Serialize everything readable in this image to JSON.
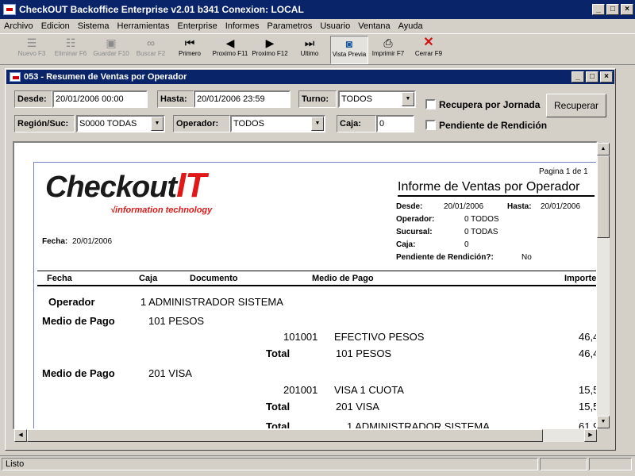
{
  "window": {
    "title": "CheckOUT Backoffice Enterprise v2.01 b341 Conexion: LOCAL"
  },
  "menu": [
    "Archivo",
    "Edicion",
    "Sistema",
    "Herramientas",
    "Enterprise",
    "Informes",
    "Parametros",
    "Usuario",
    "Ventana",
    "Ayuda"
  ],
  "toolbar": {
    "nuevo": "Nuevo F3",
    "eliminar": "Eliminar F6",
    "guardar": "Guardar F10",
    "buscar": "Buscar F2",
    "primero": "Primero",
    "proximo_f11": "Proximo F11",
    "proximo_f12": "Proximo F12",
    "ultimo": "Ultimo",
    "vista": "Vista Previa",
    "imprimir": "Imprimir F7",
    "cerrar": "Cerrar F9"
  },
  "child": {
    "title": "053 - Resumen de Ventas por Operador"
  },
  "filters": {
    "desde_label": "Desde:",
    "desde": "20/01/2006 00:00",
    "hasta_label": "Hasta:",
    "hasta": "20/01/2006 23:59",
    "turno_label": "Turno:",
    "turno": "TODOS",
    "region_label": "Región/Suc:",
    "region": "S0000 TODAS",
    "operador_label": "Operador:",
    "operador": "TODOS",
    "caja_label": "Caja:",
    "caja": "0",
    "recupera_jornada": "Recupera por Jornada",
    "pendiente": "Pendiente de Rendición",
    "recuperar": "Recuperar"
  },
  "report": {
    "logo_text": "Checkout",
    "logo_it": "IT",
    "logo_sub": "information technology",
    "pagina": "Pagina 1 de 1",
    "title": "Informe de Ventas por Operador",
    "desde_l": "Desde:",
    "desde_v": "20/01/2006",
    "hasta_l": "Hasta:",
    "hasta_v": "20/01/2006",
    "operador_l": "Operador:",
    "operador_v": "0 TODOS",
    "sucursal_l": "Sucursal:",
    "sucursal_v": "0 TODAS",
    "caja_l": "Caja:",
    "caja_v": "0",
    "pend_l": "Pendiente de Rendición?:",
    "pend_v": "No",
    "fecha_l": "Fecha:",
    "fecha_v": "20/01/2006",
    "cols": {
      "fecha": "Fecha",
      "caja": "Caja",
      "documento": "Documento",
      "medio": "Medio de Pago",
      "importe": "Importe"
    },
    "operador_row_l": "Operador",
    "operador_row_v": "1  ADMINISTRADOR SISTEMA",
    "mp1_l": "Medio de Pago",
    "mp1_v": "101  PESOS",
    "mp1_code": "101001",
    "mp1_desc": "EFECTIVO PESOS",
    "mp1_amt": "46,4",
    "total1_l": "Total",
    "total1_v": "101  PESOS",
    "total1_amt": "46,4",
    "mp2_l": "Medio de Pago",
    "mp2_v": "201  VISA",
    "mp2_code": "201001",
    "mp2_desc": "VISA 1 CUOTA",
    "mp2_amt": "15,5",
    "total2_l": "Total",
    "total2_v": "201  VISA",
    "total2_amt": "15,5",
    "total3_l": "Total",
    "total3_v": "1  ADMINISTRADOR SISTEMA",
    "total3_amt": "61,9"
  },
  "status": {
    "text": "Listo"
  }
}
